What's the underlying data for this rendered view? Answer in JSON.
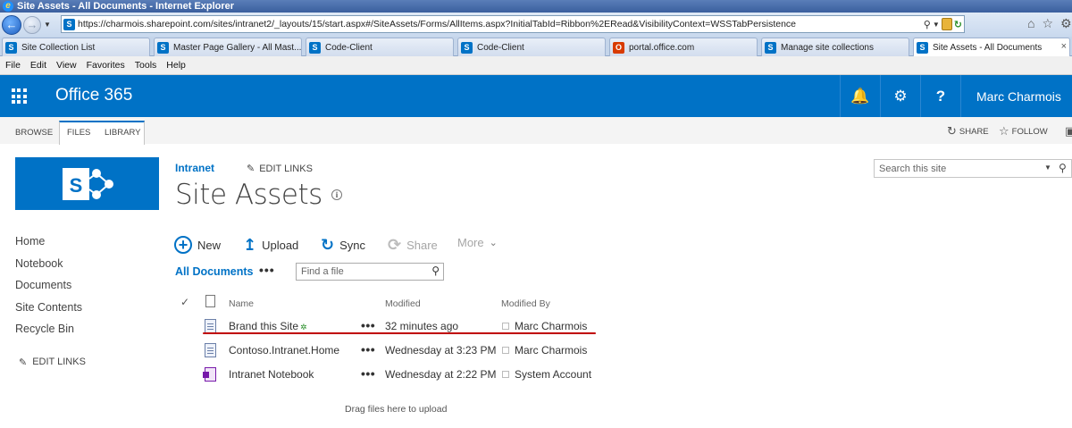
{
  "browser": {
    "window_title": "Site Assets - All Documents - Internet Explorer",
    "url": "https://charmois.sharepoint.com/sites/intranet2/_layouts/15/start.aspx#/SiteAssets/Forms/AllItems.aspx?InitialTabId=Ribbon%2ERead&VisibilityContext=WSSTabPersistence",
    "tabs": [
      {
        "label": "Site Collection List",
        "icon": "sharepoint-icon"
      },
      {
        "label": "Master Page Gallery - All Mast...",
        "icon": "sharepoint-icon"
      },
      {
        "label": "Code-Client",
        "icon": "sharepoint-icon"
      },
      {
        "label": "Code-Client",
        "icon": "sharepoint-icon"
      },
      {
        "label": "portal.office.com",
        "icon": "office-icon"
      },
      {
        "label": "Manage site collections",
        "icon": "sharepoint-icon"
      },
      {
        "label": "Site Assets - All Documents",
        "icon": "sharepoint-icon",
        "active": true
      }
    ],
    "menu": [
      "File",
      "Edit",
      "View",
      "Favorites",
      "Tools",
      "Help"
    ]
  },
  "suite": {
    "brand": "Office 365",
    "user": "Marc Charmois",
    "accent": "#0072c6"
  },
  "ribbon": {
    "tabs": [
      "BROWSE",
      "FILES",
      "LIBRARY"
    ],
    "share": "SHARE",
    "follow": "FOLLOW"
  },
  "site": {
    "breadcrumb": "Intranet",
    "edit_links": "EDIT LINKS",
    "title": "Site Assets",
    "search_placeholder": "Search this site",
    "logo_letter": "S"
  },
  "quick_launch": {
    "items": [
      "Home",
      "Notebook",
      "Documents",
      "Site Contents",
      "Recycle Bin"
    ],
    "edit_links": "EDIT LINKS"
  },
  "commands": {
    "new": "New",
    "upload": "Upload",
    "sync": "Sync",
    "share": "Share",
    "more": "More"
  },
  "view": {
    "name": "All Documents",
    "find_placeholder": "Find a file"
  },
  "list": {
    "columns": [
      "Name",
      "Modified",
      "Modified By"
    ],
    "rows": [
      {
        "name": "Brand this Site",
        "new_marker": "✲",
        "modified": "32 minutes ago",
        "modified_by": "Marc Charmois",
        "type": "page"
      },
      {
        "name": "Contoso.Intranet.Home",
        "modified": "Wednesday at 3:23 PM",
        "modified_by": "Marc Charmois",
        "type": "page"
      },
      {
        "name": "Intranet Notebook",
        "modified": "Wednesday at 2:22 PM",
        "modified_by": "System Account",
        "type": "onenote"
      }
    ],
    "drag_hint": "Drag files here to upload",
    "annotation_color": "#c00000"
  }
}
